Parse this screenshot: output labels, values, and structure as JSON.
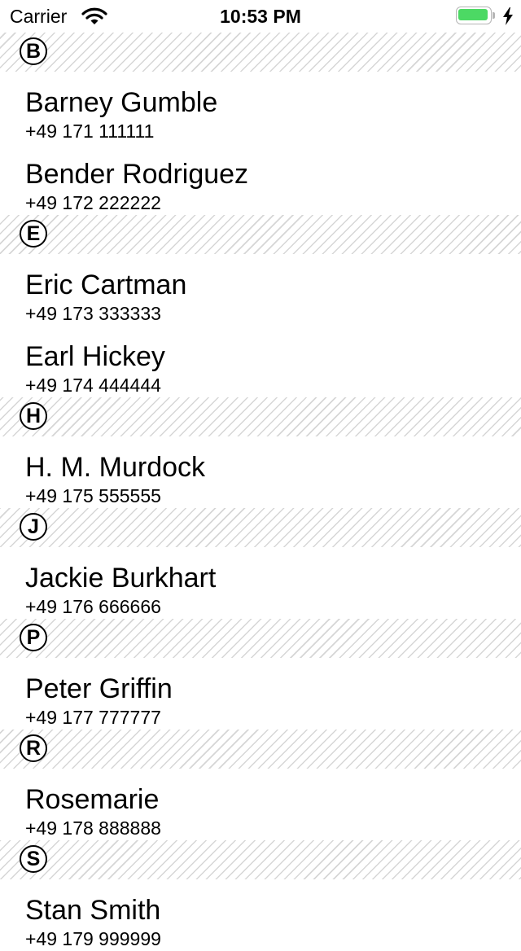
{
  "status_bar": {
    "carrier": "Carrier",
    "time": "10:53 PM",
    "icons": [
      "wifi-icon",
      "battery-icon",
      "charging-bolt-icon"
    ],
    "battery_color": "#4cd964"
  },
  "sections": [
    {
      "letter": "B",
      "contacts": [
        {
          "name": "Barney Gumble",
          "phone": "+49 171 111111"
        },
        {
          "name": "Bender Rodriguez",
          "phone": "+49 172 222222"
        }
      ]
    },
    {
      "letter": "E",
      "contacts": [
        {
          "name": "Eric Cartman",
          "phone": "+49 173 333333"
        },
        {
          "name": "Earl Hickey",
          "phone": "+49 174 444444"
        }
      ]
    },
    {
      "letter": "H",
      "contacts": [
        {
          "name": "H. M. Murdock",
          "phone": "+49 175 555555"
        }
      ]
    },
    {
      "letter": "J",
      "contacts": [
        {
          "name": "Jackie Burkhart",
          "phone": "+49 176 666666"
        }
      ]
    },
    {
      "letter": "P",
      "contacts": [
        {
          "name": "Peter Griffin",
          "phone": "+49 177 777777"
        }
      ]
    },
    {
      "letter": "R",
      "contacts": [
        {
          "name": "Rosemarie",
          "phone": "+49 178 888888"
        }
      ]
    },
    {
      "letter": "S",
      "contacts": [
        {
          "name": "Stan Smith",
          "phone": "+49 179 999999"
        }
      ]
    }
  ]
}
